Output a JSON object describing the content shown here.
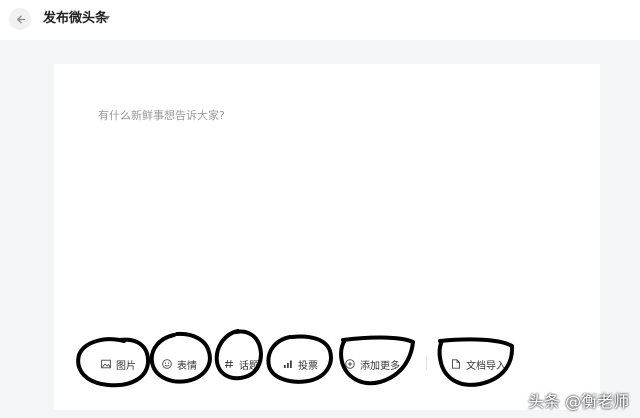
{
  "header": {
    "title": "发布微头条",
    "back_icon": "back-arrow-icon"
  },
  "editor": {
    "placeholder": "有什么新鲜事想告诉大家?"
  },
  "toolbar": {
    "items": [
      {
        "label": "图片",
        "icon": "image-icon"
      },
      {
        "label": "表情",
        "icon": "emoji-icon"
      },
      {
        "label": "话题",
        "icon": "hashtag-icon"
      },
      {
        "label": "投票",
        "icon": "poll-icon"
      },
      {
        "label": "添加更多",
        "icon": "plus-circle-icon"
      },
      {
        "label": "文档导入",
        "icon": "document-icon"
      }
    ]
  },
  "watermark": "头条 @衡老师",
  "colors": {
    "background": "#f4f5f6",
    "panel": "#ffffff",
    "annotation": "#000000"
  }
}
